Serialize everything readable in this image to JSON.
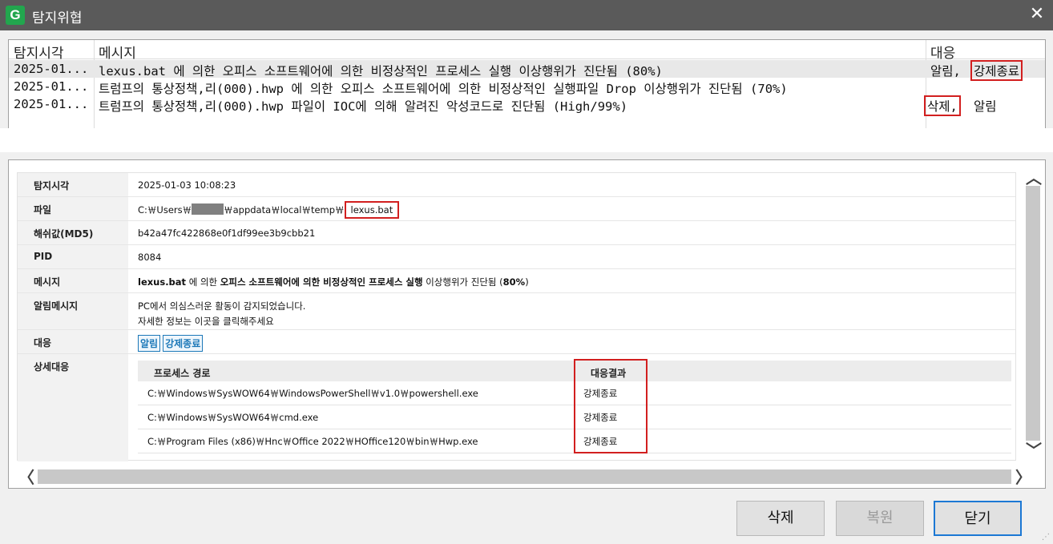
{
  "window": {
    "title": "탐지위협",
    "logo_letter": "G"
  },
  "list": {
    "columns": [
      "탐지시각",
      "메시지",
      "대응"
    ],
    "rows": [
      {
        "time": "2025-01...",
        "message": "lexus.bat 에 의한 오피스 소프트웨어에 의한 비정상적인 프로세스 실행 이상행위가 진단됨 (80%)",
        "resp_a": "알림,",
        "resp_b": "강제종료"
      },
      {
        "time": "2025-01...",
        "message": "트럼프의 통상정책,리(000).hwp 에 의한 오피스 소프트웨어에 의한 비정상적인 실행파일 Drop 이상행위가 진단됨 (70%)",
        "resp_a": "",
        "resp_b": ""
      },
      {
        "time": "2025-01...",
        "message": "트럼프의 통상정책,리(000).hwp 파일이 IOC에 의해 알려진 악성코드로 진단됨 (High/99%)",
        "resp_a": "삭제,",
        "resp_b": "알림"
      }
    ]
  },
  "detail": {
    "time_label": "탐지시각",
    "time_value": "2025-01-03 10:08:23",
    "file_label": "파일",
    "file_prefix": "C:￦Users￦",
    "file_middle": "￦appdata￦local￦temp￦",
    "file_name": "lexus.bat",
    "hash_label": "해쉬값(MD5)",
    "hash_value": "b42a47fc422868e0f1df99ee3b9cbb21",
    "pid_label": "PID",
    "pid_value": "8084",
    "msg_label": "메시지",
    "msg_part1": "lexus.bat",
    "msg_part2": " 에 의한 ",
    "msg_part3": "오피스 소프트웨어에 의한 비정상적인 프로세스 실행",
    "msg_part4": " 이상행위가 진단됨 (",
    "msg_part5": "80%",
    "msg_part6": ")",
    "alert_label": "알림메시지",
    "alert_line1": "PC에서 의심스러운 활동이 감지되었습니다.",
    "alert_line2": "자세한 정보는 이곳을 클릭해주세요",
    "resp_label": "대응",
    "resp_tags": [
      "알림",
      "강제종료"
    ],
    "detail_label": "상세대응",
    "sub_headers": [
      "프로세스 경로",
      "대응결과"
    ],
    "sub_rows": [
      {
        "path": "C:￦Windows￦SysWOW64￦WindowsPowerShell￦v1.0￦powershell.exe",
        "result": "강제종료"
      },
      {
        "path": "C:￦Windows￦SysWOW64￦cmd.exe",
        "result": "강제종료"
      },
      {
        "path": "C:￦Program Files (x86)￦Hnc￦Office 2022￦HOffice120￦bin￦Hwp.exe",
        "result": "강제종료"
      }
    ]
  },
  "buttons": {
    "delete": "삭제",
    "restore": "복원",
    "close": "닫기"
  }
}
